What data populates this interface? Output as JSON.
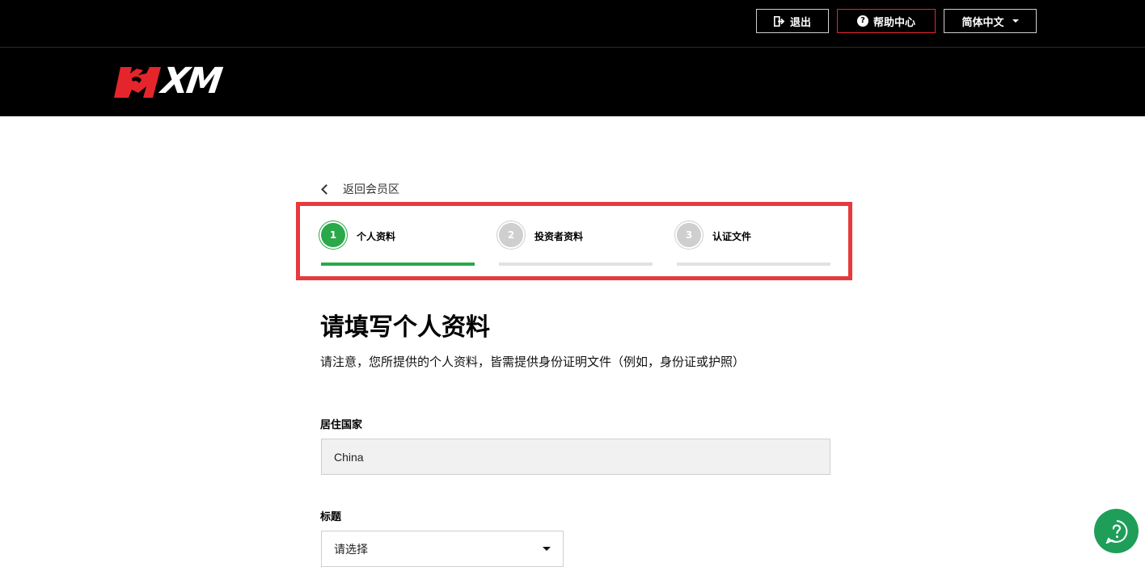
{
  "topbar": {
    "logout_label": "退出",
    "help_label": "帮助中心",
    "language_label": "简体中文",
    "icons": [
      "logout-icon",
      "help-circle-icon",
      "caret-down-icon"
    ]
  },
  "brand": {
    "logo_text": "XM",
    "accent_color": "#e4262c"
  },
  "nav": {
    "back_label": "返回会员区"
  },
  "stepper": {
    "active_color": "#2aa84a",
    "inactive_color": "#cfcfcf",
    "steps": [
      {
        "number": "1",
        "label": "个人资料",
        "active": true
      },
      {
        "number": "2",
        "label": "投资者资料",
        "active": false
      },
      {
        "number": "3",
        "label": "认证文件",
        "active": false
      }
    ]
  },
  "form": {
    "heading": "请填写个人资料",
    "note": "请注意，您所提供的个人资料，皆需提供身份证明文件（例如，身份证或护照）",
    "country_label": "居住国家",
    "country_value": "China",
    "title_label": "标题",
    "title_value": "请选择"
  },
  "fab": {
    "icon": "help-chat-icon",
    "color": "#1f9e5a"
  }
}
